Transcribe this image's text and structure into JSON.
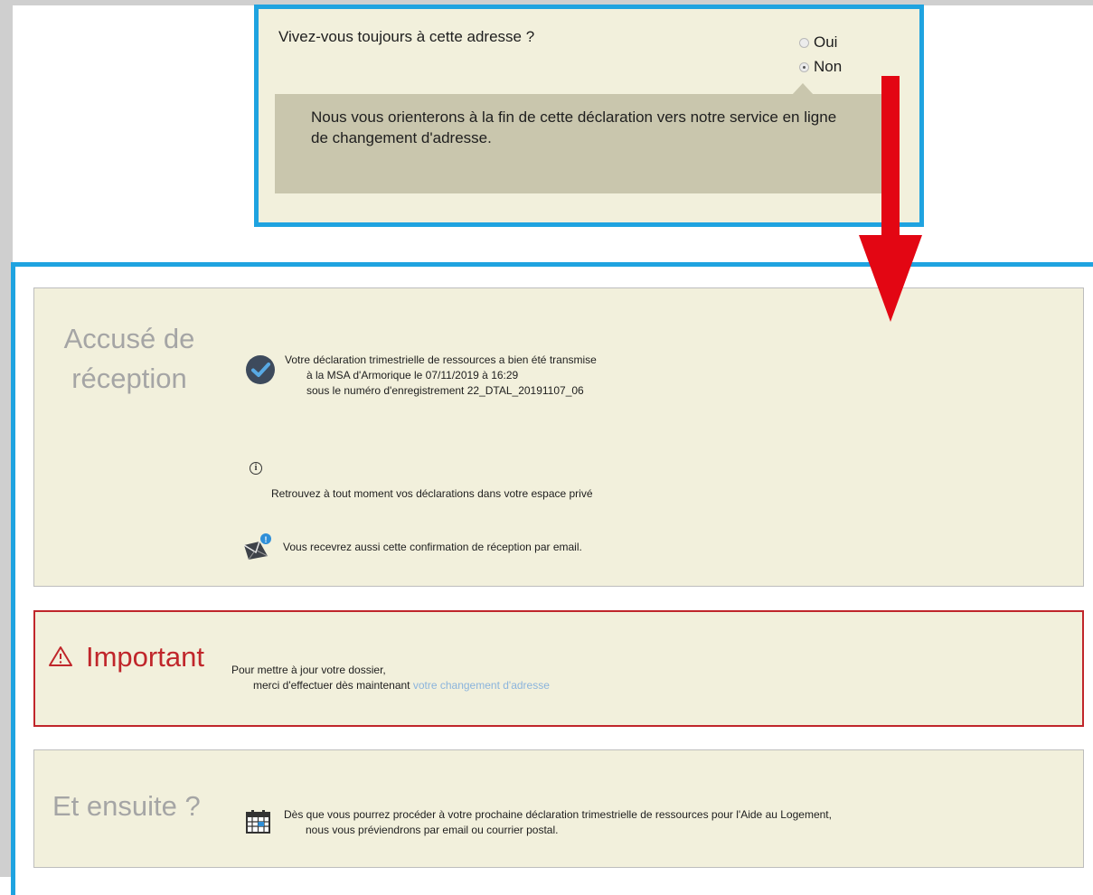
{
  "question": {
    "label": "Vivez-vous toujours à cette adresse ?",
    "options": [
      {
        "label": "Oui",
        "selected": false
      },
      {
        "label": "Non",
        "selected": true
      }
    ],
    "info_message": "Nous vous orienterons à la fin de cette déclaration vers notre service en ligne de changement d'adresse."
  },
  "receipt": {
    "title": "Accusé de réception",
    "confirmation_lines": [
      "Votre déclaration trimestrielle de ressources a bien été transmise",
      "à la MSA d'Armorique le 07/11/2019 à 16:29",
      "sous le numéro d'enregistrement 22_DTAL_20191107_06"
    ],
    "private_space_text": "Retrouvez à tout moment vos déclarations dans votre espace privé",
    "email_text": "Vous recevrez aussi cette confirmation de réception par email."
  },
  "important": {
    "title": "Important",
    "line1": "Pour mettre à jour votre dossier,",
    "line2_prefix": "merci d'effectuer dès maintenant ",
    "link_text": "votre changement d'adresse"
  },
  "next": {
    "title": "Et ensuite ?",
    "line1": "Dès que vous pourrez procéder à votre prochaine déclaration trimestrielle de ressources pour l'Aide au Logement,",
    "line2": "nous vous préviendrons par email ou courrier postal."
  },
  "colors": {
    "highlight_border": "#1fa3e0",
    "arrow": "#e30613",
    "panel_background": "#f2f0dc",
    "important": "#c0262b",
    "link": "#8bb4dc"
  },
  "icons": [
    "check-circle-icon",
    "info-icon",
    "mail-notification-icon",
    "warning-icon",
    "calendar-icon",
    "down-arrow-icon"
  ]
}
